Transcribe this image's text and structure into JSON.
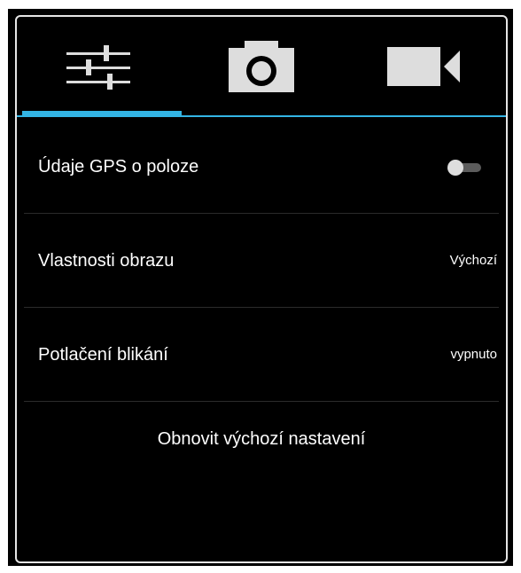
{
  "tabs": [
    {
      "name": "settings",
      "icon": "sliders-icon",
      "selected": true
    },
    {
      "name": "photo",
      "icon": "camera-icon",
      "selected": false
    },
    {
      "name": "video",
      "icon": "video-camera-icon",
      "selected": false
    }
  ],
  "colors": {
    "accent": "#33b5e5",
    "background": "#000000",
    "text": "#ffffff",
    "icon": "#dddddd"
  },
  "settings": {
    "gps": {
      "label": "Údaje GPS o poloze",
      "enabled": false
    },
    "image_properties": {
      "label": "Vlastnosti obrazu",
      "value": "Výchozí"
    },
    "anti_flicker": {
      "label": "Potlačení blikání",
      "value": "vypnuto"
    }
  },
  "reset_label": "Obnovit výchozí nastavení"
}
